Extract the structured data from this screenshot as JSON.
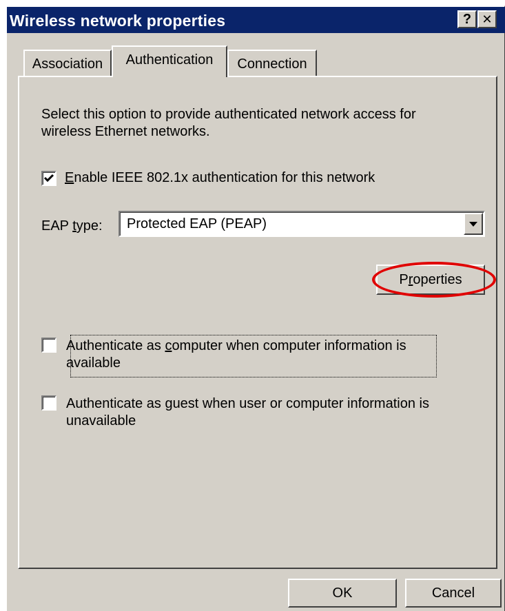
{
  "window": {
    "title": "Wireless network properties",
    "help_button": "?",
    "close_button": "✕"
  },
  "tabs": [
    {
      "label": "Association",
      "selected": false
    },
    {
      "label": "Authentication",
      "selected": true
    },
    {
      "label": "Connection",
      "selected": false
    }
  ],
  "authentication": {
    "description_line1": "Select this option to provide authenticated network access for",
    "description_line2": "wireless Ethernet networks.",
    "enable_8021x": {
      "checked": true,
      "mnemonic": "E",
      "label_rest": "nable IEEE 802.1x authentication for this network"
    },
    "eap_type": {
      "label_pre": "EAP ",
      "mnemonic": "t",
      "label_post": "ype:",
      "value": "Protected EAP (PEAP)"
    },
    "properties_button": {
      "pre": "P",
      "mnemonic": "r",
      "post": "operties"
    },
    "auth_as_computer": {
      "checked": false,
      "pre": "Authenticate as ",
      "mnemonic": "c",
      "post": "omputer when computer information is",
      "line2": "available"
    },
    "auth_as_guest": {
      "checked": false,
      "pre": "Authenticate as ",
      "mnemonic": "g",
      "post": "uest when user or computer information is",
      "line2": "unavailable"
    }
  },
  "footer": {
    "ok_label": "OK",
    "cancel_label": "Cancel"
  },
  "colors": {
    "titlebar": "#0a246a",
    "dialog_face": "#d4d0c8",
    "highlight_ellipse": "#e00000"
  }
}
